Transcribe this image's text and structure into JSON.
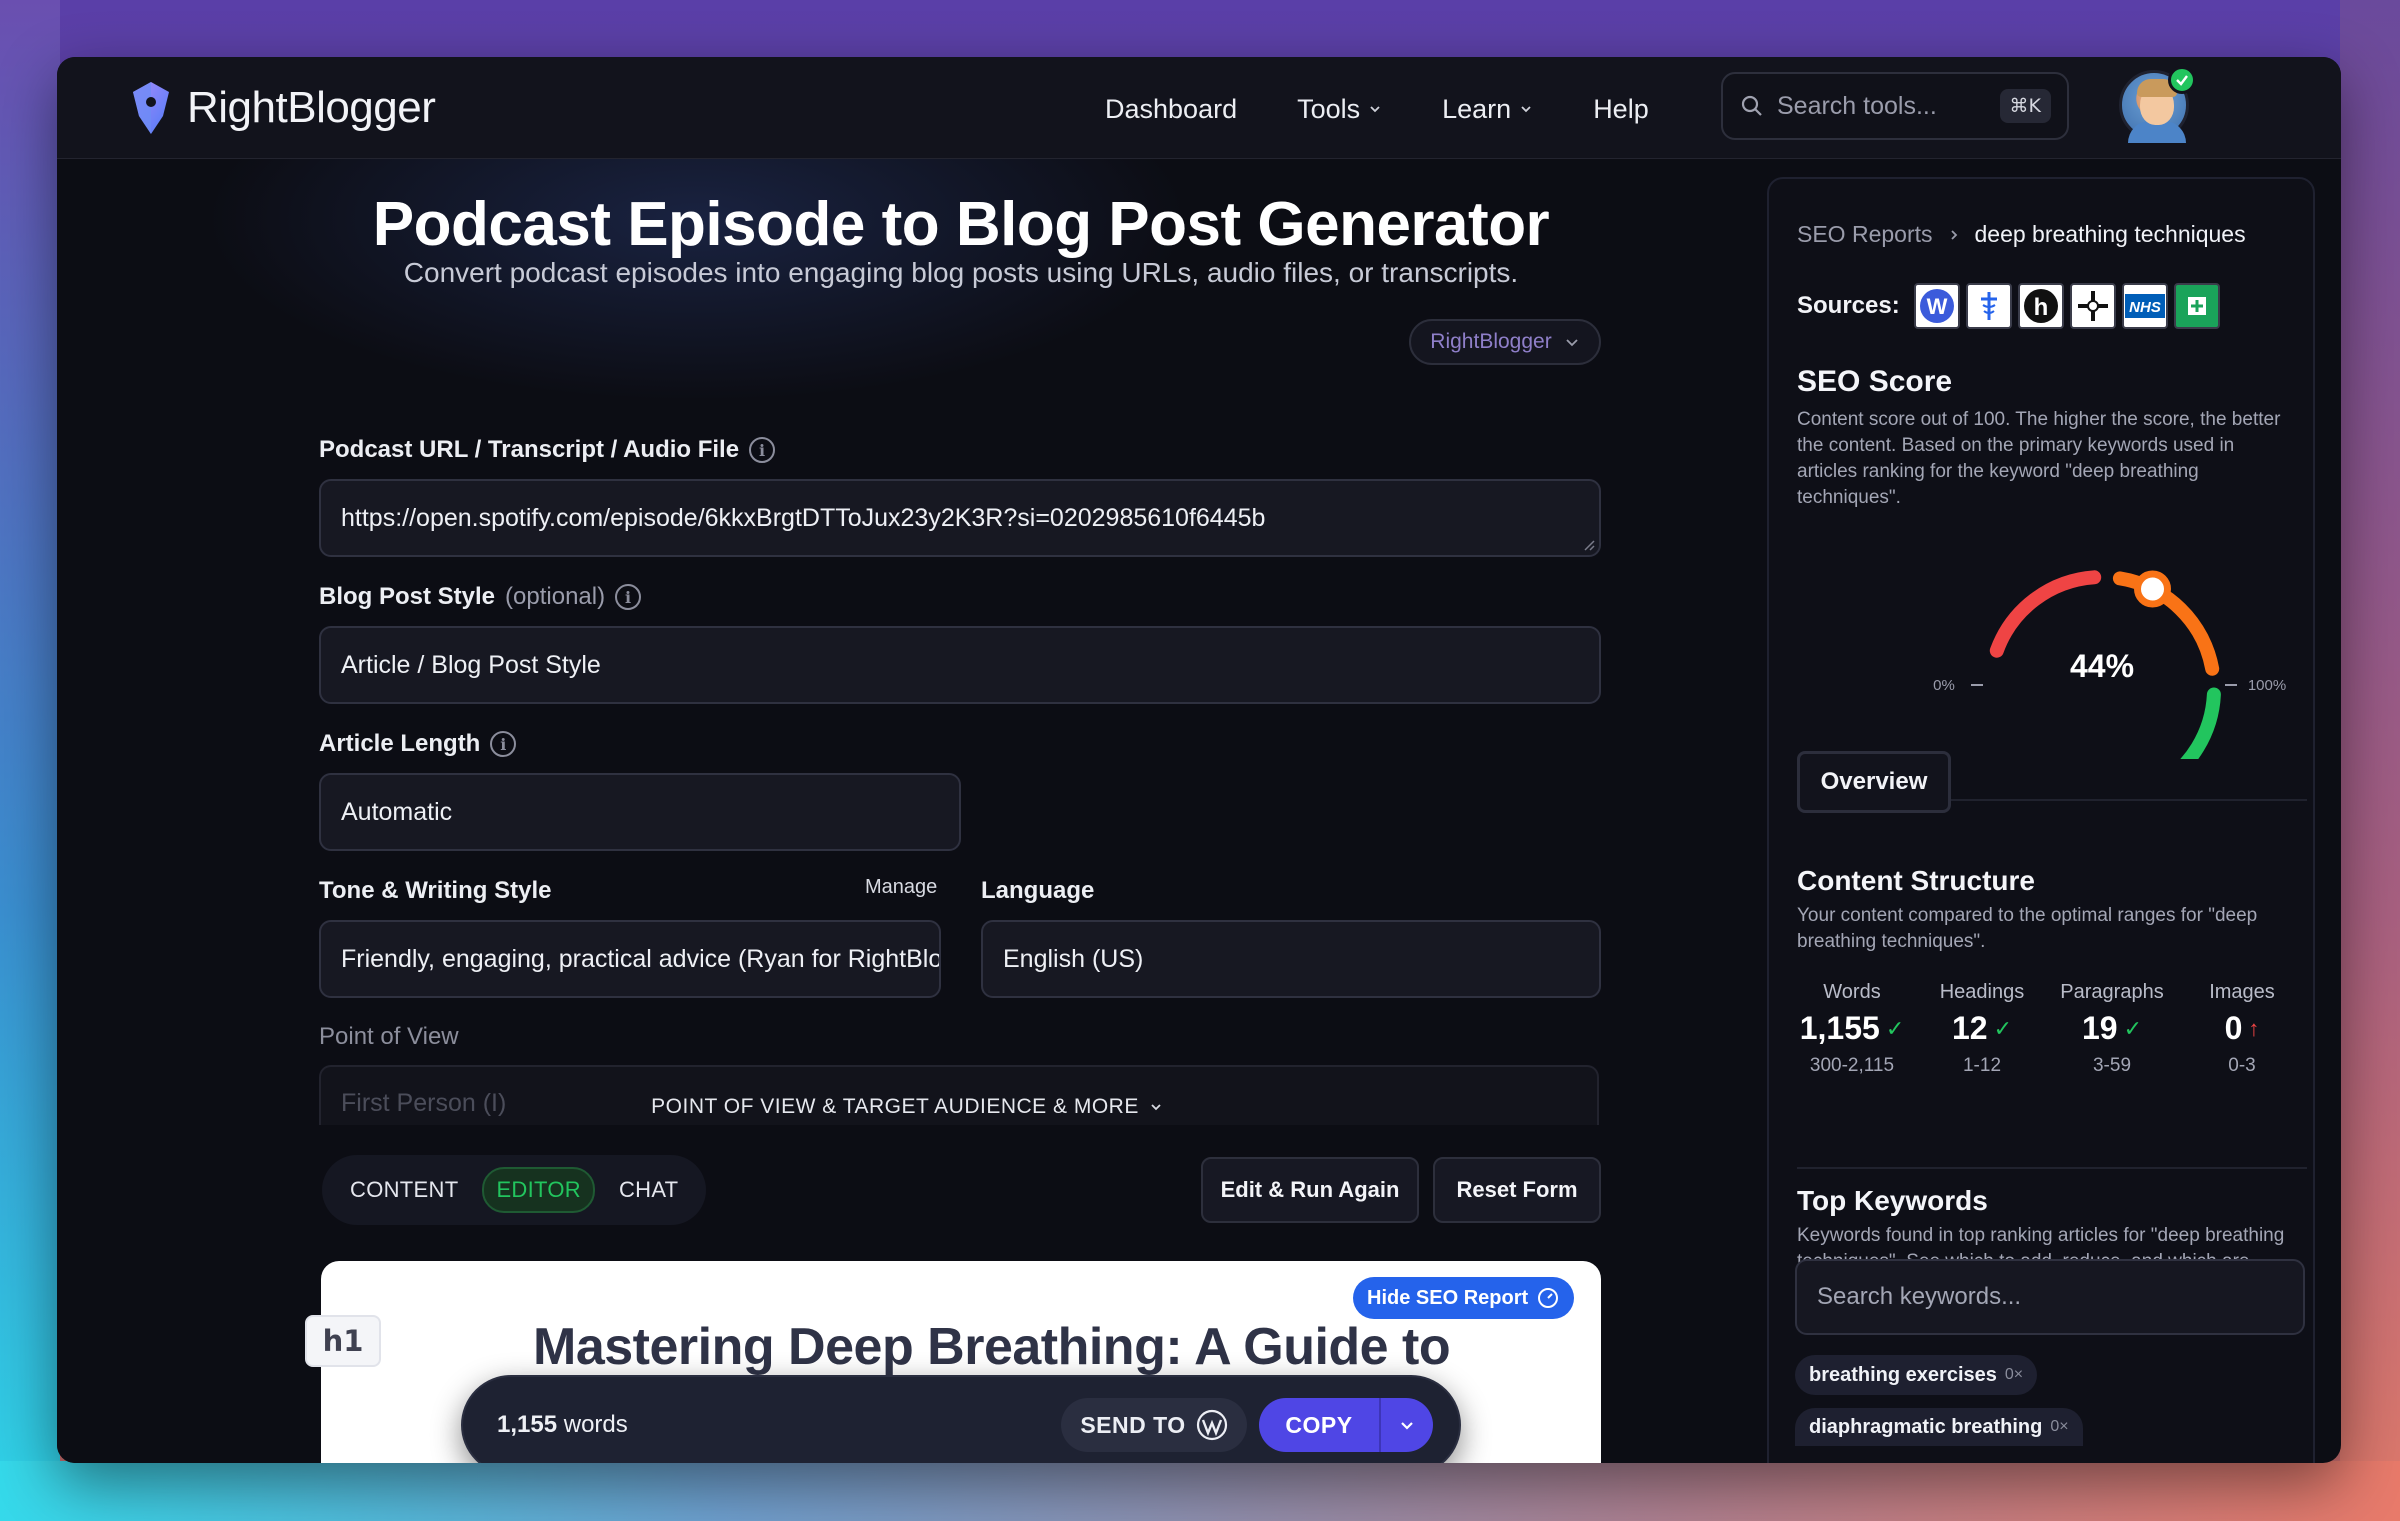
{
  "app": {
    "brand": "RightBlogger",
    "nav": [
      {
        "label": "Dashboard",
        "dropdown": false
      },
      {
        "label": "Tools",
        "dropdown": true
      },
      {
        "label": "Learn",
        "dropdown": true
      },
      {
        "label": "Help",
        "dropdown": false
      }
    ],
    "search": {
      "placeholder": "Search tools...",
      "shortcut": "⌘K"
    }
  },
  "page": {
    "title": "Podcast Episode to Blog Post Generator",
    "subtitle": "Convert podcast episodes into engaging blog posts using URLs, audio files, or transcripts.",
    "brand_select": "RightBlogger"
  },
  "form": {
    "podcast_label": "Podcast URL / Transcript / Audio File",
    "podcast_value": "https://open.spotify.com/episode/6kkxBrgtDTToJux23y2K3R?si=0202985610f6445b",
    "style_label": "Blog Post Style",
    "style_optional": "(optional)",
    "style_value": "Article / Blog Post Style",
    "length_label": "Article Length",
    "length_value": "Automatic",
    "tone_label": "Tone & Writing Style",
    "tone_manage": "Manage",
    "tone_value": "Friendly, engaging, practical advice (Ryan for RightBlogger)",
    "language_label": "Language",
    "language_value": "English (US)",
    "pov_label": "Point of View",
    "pov_value": "First Person (I)",
    "more_toggle": "POINT OF VIEW & TARGET AUDIENCE & MORE"
  },
  "tabs": [
    {
      "label": "CONTENT",
      "active": false
    },
    {
      "label": "EDITOR",
      "active": true
    },
    {
      "label": "CHAT",
      "active": false
    }
  ],
  "actions": {
    "edit_run": "Edit & Run Again",
    "reset": "Reset Form"
  },
  "editor": {
    "heading_badge": "h1",
    "hide_seo": "Hide SEO Report",
    "article_title": "Mastering Deep Breathing: A Guide to Calm Your Mind and Chest"
  },
  "floatbar": {
    "word_count": "1,155",
    "word_unit": "words",
    "send_to": "SEND TO",
    "copy": "COPY"
  },
  "seo": {
    "crumb_root": "SEO Reports",
    "crumb_current": "deep breathing techniques",
    "sources_label": "Sources:",
    "score_title": "SEO Score",
    "score_desc": "Content score out of 100. The higher the score, the better the content. Based on the primary keywords used in articles ranking for the keyword \"deep breathing techniques\".",
    "score_percent": 44,
    "score_text": "44%",
    "gauge_min": "0%",
    "gauge_max": "100%",
    "overview_tab": "Overview",
    "structure_title": "Content Structure",
    "structure_desc": "Your content compared to the optimal ranges for \"deep breathing techniques\".",
    "stats": [
      {
        "label": "Words",
        "value": "1,155",
        "range": "300-2,115",
        "status": "ok"
      },
      {
        "label": "Headings",
        "value": "12",
        "range": "1-12",
        "status": "ok"
      },
      {
        "label": "Paragraphs",
        "value": "19",
        "range": "3-59",
        "status": "ok"
      },
      {
        "label": "Images",
        "value": "0",
        "range": "0-3",
        "status": "low"
      }
    ],
    "keywords_title": "Top Keywords",
    "keywords_desc": "Keywords found in top ranking articles for \"deep breathing techniques\". See which to add, reduce, and which are completed.",
    "keywords_search_placeholder": "Search keywords...",
    "keywords": [
      {
        "term": "breathing exercises",
        "count": "0×"
      },
      {
        "term": "diaphragmatic breathing",
        "count": "0×"
      }
    ]
  },
  "colors": {
    "accent": "#4f46e5",
    "success": "#22c55e",
    "warning": "#f97316",
    "danger": "#ef4444",
    "link_blue": "#2563eb"
  }
}
